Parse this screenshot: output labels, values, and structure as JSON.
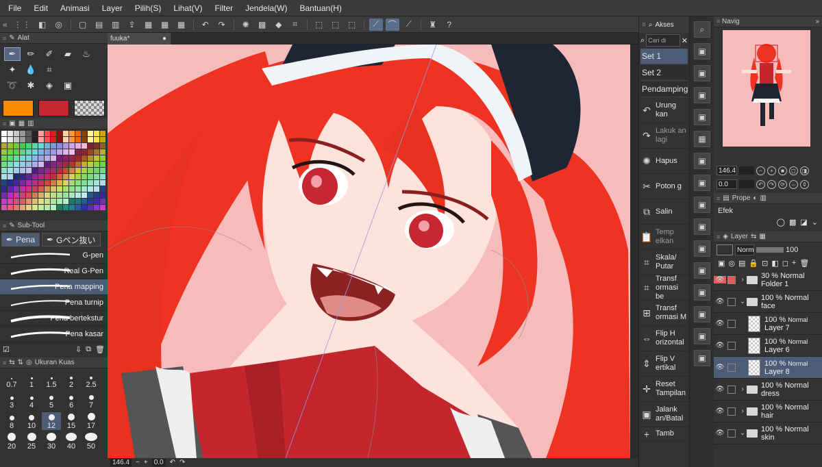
{
  "menu": [
    "File",
    "Edit",
    "Animasi",
    "Layer",
    "Pilih(S)",
    "Lihat(V)",
    "Filter",
    "Jendela(W)",
    "Bantuan(H)"
  ],
  "tool_panel": {
    "title": "Alat"
  },
  "colors": {
    "main": "#ff8c00",
    "sub": "#c62833",
    "canvas_bg": "#f7bbbb",
    "accent": "#4c5c75"
  },
  "subtool": {
    "title": "Sub-Tool",
    "tabs": [
      "Pena",
      "Gペン抜い"
    ],
    "brushes": [
      "G-pen",
      "Real G-Pen",
      "Pena mapping",
      "Pena turnip",
      "Pena bertekstur",
      "Pena kasar"
    ],
    "selected_brush": "Pena mapping"
  },
  "brush_size": {
    "title": "Ukuran Kuas",
    "values": [
      "0.7",
      "1",
      "1.5",
      "2",
      "2.5",
      "3",
      "4",
      "5",
      "6",
      "7",
      "8",
      "10",
      "12",
      "15",
      "17",
      "20",
      "25",
      "30",
      "40",
      "50"
    ],
    "selected": "12"
  },
  "document": {
    "tab_name": "fuuka*"
  },
  "status": {
    "zoom": "146.4",
    "angle": "0.0"
  },
  "auto_action": {
    "title": "Akses",
    "search_placeholder": "Cari di",
    "sets": [
      "Set 1",
      "Set 2",
      "Pendamping"
    ],
    "selected_set": "Set 1",
    "commands": [
      {
        "label": "Urung kan",
        "icon": "undo-icon",
        "enabled": true
      },
      {
        "label": "Lakuk an lagi",
        "icon": "redo-icon",
        "enabled": false
      },
      {
        "label": "Hapus",
        "icon": "clear-icon",
        "enabled": true
      },
      {
        "label": "Poton g",
        "icon": "cut-icon",
        "enabled": true
      },
      {
        "label": "Salin",
        "icon": "copy-icon",
        "enabled": true
      },
      {
        "label": "Temp elkan",
        "icon": "paste-icon",
        "enabled": false
      },
      {
        "label": "Skala/ Putar",
        "icon": "scale-rotate-icon",
        "enabled": true
      },
      {
        "label": "Transf ormasi be",
        "icon": "free-transform-icon",
        "enabled": true
      },
      {
        "label": "Transf ormasi M",
        "icon": "mesh-transform-icon",
        "enabled": true
      },
      {
        "label": "Flip H orizontal",
        "icon": "flip-horizontal-icon",
        "enabled": true
      },
      {
        "label": "Flip V ertikal",
        "icon": "flip-vertical-icon",
        "enabled": true
      },
      {
        "label": "Reset Tampilan",
        "icon": "reset-view-icon",
        "enabled": true
      },
      {
        "label": "Jalank an/Batal",
        "icon": "run-icon",
        "enabled": true
      },
      {
        "label": "Tamb",
        "icon": "add-icon",
        "enabled": true
      }
    ]
  },
  "navigator": {
    "title": "Navig",
    "zoom": "146.4",
    "angle": "0.0"
  },
  "property": {
    "title": "Prope",
    "effect_label": "Efek"
  },
  "layer_panel": {
    "title": "Layer",
    "blend_mode": "Norm",
    "opacity": "100",
    "layers": [
      {
        "opacity": "30 %",
        "mode": "Normal",
        "name": "Folder 1",
        "type": "folder",
        "expanded": false,
        "indent": 0
      },
      {
        "opacity": "100 %",
        "mode": "Normal",
        "name": "face",
        "type": "folder",
        "expanded": true,
        "indent": 0
      },
      {
        "opacity": "100 %",
        "mode": "Normal",
        "name": "Layer 7",
        "type": "raster",
        "indent": 1
      },
      {
        "opacity": "100 %",
        "mode": "Normal",
        "name": "Layer 6",
        "type": "raster",
        "indent": 1
      },
      {
        "opacity": "100 %",
        "mode": "Normal",
        "name": "Layer 8",
        "type": "raster",
        "indent": 1,
        "selected": true
      },
      {
        "opacity": "100 %",
        "mode": "Normal",
        "name": "dress",
        "type": "folder",
        "expanded": false,
        "indent": 0
      },
      {
        "opacity": "100 %",
        "mode": "Normal",
        "name": "hair",
        "type": "folder",
        "expanded": false,
        "indent": 0
      },
      {
        "opacity": "100 %",
        "mode": "Normal",
        "name": "skin",
        "type": "folder",
        "expanded": true,
        "indent": 0
      }
    ]
  }
}
